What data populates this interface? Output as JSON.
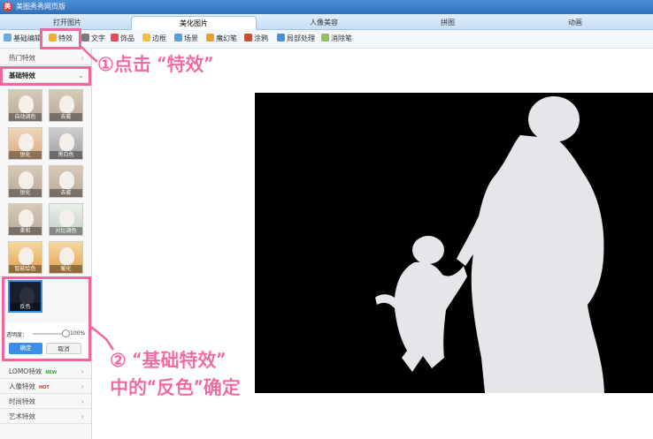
{
  "window": {
    "title": "美图秀秀网页版",
    "logo_glyph": "美"
  },
  "tabs": [
    {
      "label": "打开图片",
      "active": false
    },
    {
      "label": "美化图片",
      "active": true
    },
    {
      "label": "人像美容",
      "active": false
    },
    {
      "label": "拼图",
      "active": false
    },
    {
      "label": "动画",
      "active": false
    }
  ],
  "toolbar": [
    {
      "label": "基础编辑",
      "icon": "edit-icon"
    },
    {
      "label": "特效",
      "icon": "magic-wand-icon"
    },
    {
      "label": "文字",
      "icon": "text-icon"
    },
    {
      "label": "饰品",
      "icon": "ornament-icon"
    },
    {
      "label": "边框",
      "icon": "frame-icon"
    },
    {
      "label": "场景",
      "icon": "scene-icon"
    },
    {
      "label": "魔幻笔",
      "icon": "magic-pen-icon"
    },
    {
      "label": "涂鸦",
      "icon": "doodle-icon"
    },
    {
      "label": "局部处理",
      "icon": "local-adjust-icon"
    },
    {
      "label": "消除笔",
      "icon": "eraser-icon"
    }
  ],
  "sidebar": {
    "hot_effects": "热门特效",
    "basic_effects": "基础特效",
    "thumbnails": [
      "自动调色",
      "去雾",
      "锐化",
      "黑白色",
      "锐化",
      "去雾",
      "柔和",
      "对比调色",
      "智能绘色",
      "暖化",
      "反色"
    ],
    "opacity_label": "透明度：",
    "opacity_value": "100%",
    "opacity_level": 1.0,
    "ok_button": "确定",
    "cancel_button": "取消",
    "categories": [
      {
        "label": "LOMO特效",
        "badge": "NEW",
        "badge_color": "#3aa83a"
      },
      {
        "label": "人像特效",
        "badge": "HOT",
        "badge_color": "#e02a2a"
      },
      {
        "label": "时尚特效",
        "badge": ""
      },
      {
        "label": "艺术特效",
        "badge": ""
      }
    ],
    "chevron": "›"
  },
  "annotations": {
    "step1": "①点击 “特效”",
    "step2_line1": "②  “基础特效”",
    "step2_line2": "中的“反色”确定",
    "color": "#f266a0"
  }
}
